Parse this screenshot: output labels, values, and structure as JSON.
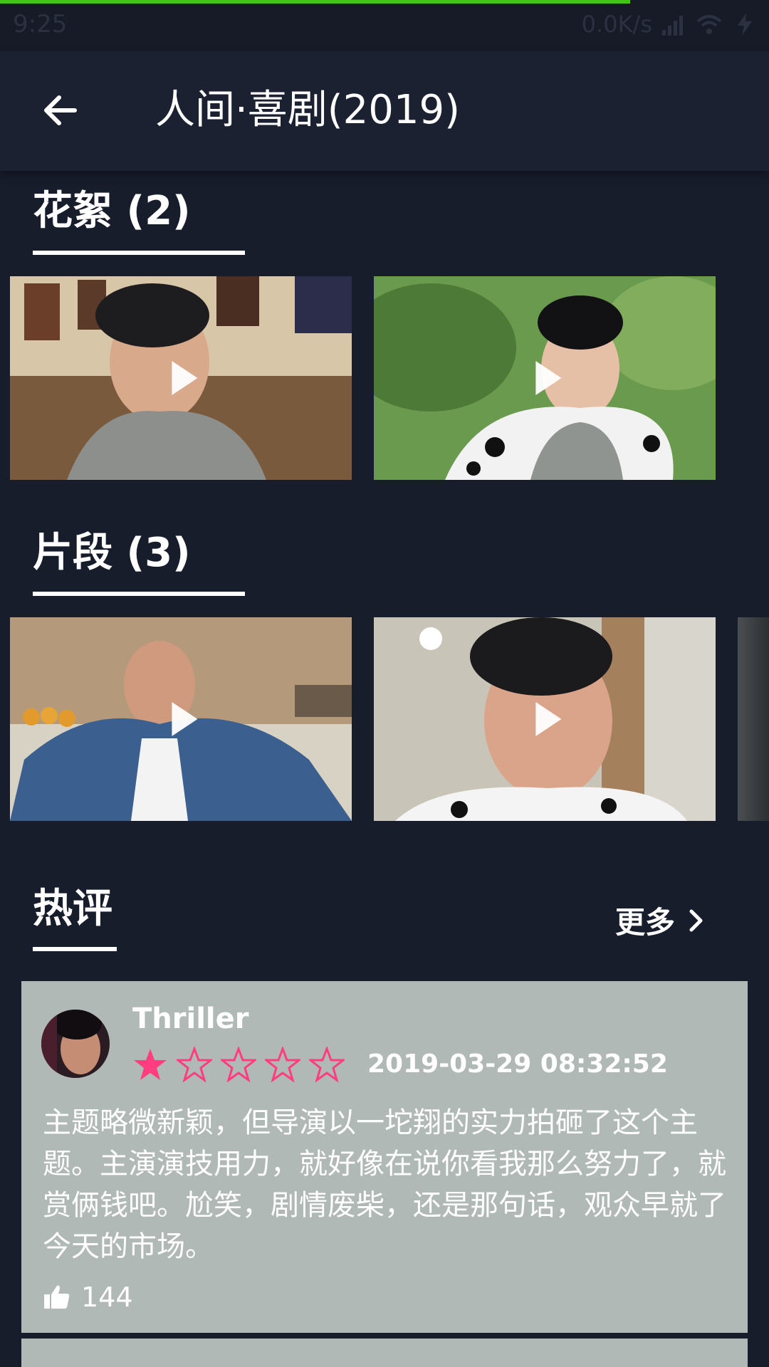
{
  "status_bar": {
    "time": "9:25",
    "speed": "0.0K/s",
    "icons": [
      "signal-icon",
      "wifi-icon",
      "charging-icon"
    ]
  },
  "app_bar": {
    "title": "人间·喜剧(2019)",
    "back_icon": "arrow-left-icon"
  },
  "sections": {
    "highlights": {
      "title": "花絮 (2)",
      "count": 2
    },
    "clips": {
      "title": "片段 (3)",
      "count": 3
    },
    "hot_reviews": {
      "title": "热评",
      "more_label": "更多"
    }
  },
  "reviews": [
    {
      "username": "Thriller",
      "rating": 1,
      "rating_max": 5,
      "timestamp": "2019-03-29 08:32:52",
      "text": "主题略微新颖，但导演以一坨翔的实力拍砸了这个主题。主演演技用力，就好像在说你看我那么努力了，就赏俩钱吧。尬笑，剧情废柴，还是那句话，观众早就了今天的市场。",
      "likes": "144"
    }
  ],
  "colors": {
    "background": "#181d2c",
    "app_bar": "#1b2131",
    "progress": "#43c41a",
    "star": "#ff3d7f",
    "card": "#b0b9b6"
  }
}
